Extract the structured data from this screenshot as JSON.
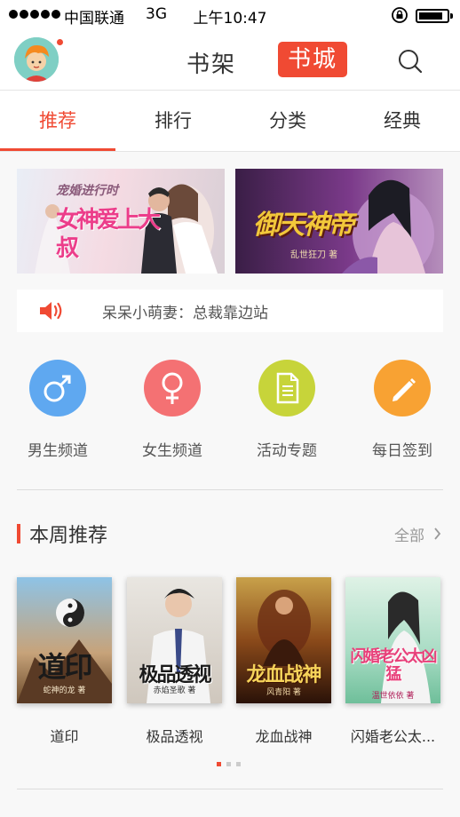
{
  "status_bar": {
    "carrier": "中国联通",
    "network": "3G",
    "time": "上午10:47"
  },
  "header": {
    "bookshelf_label": "书架",
    "bookstore_label": "书城"
  },
  "tabs": [
    {
      "label": "推荐",
      "active": true
    },
    {
      "label": "排行",
      "active": false
    },
    {
      "label": "分类",
      "active": false
    },
    {
      "label": "经典",
      "active": false
    }
  ],
  "banners": [
    {
      "title": "女神爱上大叔",
      "subtitle": "宠婚进行时"
    },
    {
      "title": "御天神帝",
      "author": "乱世狂刀 著"
    }
  ],
  "notice": {
    "text": "呆呆小萌妻：总裁靠边站"
  },
  "channels": [
    {
      "label": "男生频道",
      "icon": "male-icon",
      "color": "#5fa8f0"
    },
    {
      "label": "女生频道",
      "icon": "female-icon",
      "color": "#f47173"
    },
    {
      "label": "活动专题",
      "icon": "document-icon",
      "color": "#c7d43a"
    },
    {
      "label": "每日签到",
      "icon": "pencil-icon",
      "color": "#f8a233"
    }
  ],
  "weekly": {
    "title": "本周推荐",
    "all_label": "全部",
    "books": [
      {
        "title": "道印",
        "cover_title": "道印",
        "cover_author": "蛇神的龙 著"
      },
      {
        "title": "极品透视",
        "cover_title": "极品透视",
        "cover_author": "赤焰圣歌 著"
      },
      {
        "title": "龙血战神",
        "cover_title": "龙血战神",
        "cover_author": "风青阳 著"
      },
      {
        "title": "闪婚老公太...",
        "cover_title": "闪婚老公太凶猛",
        "cover_author": "温世依依 著"
      }
    ]
  },
  "colors": {
    "accent": "#f04a33"
  }
}
